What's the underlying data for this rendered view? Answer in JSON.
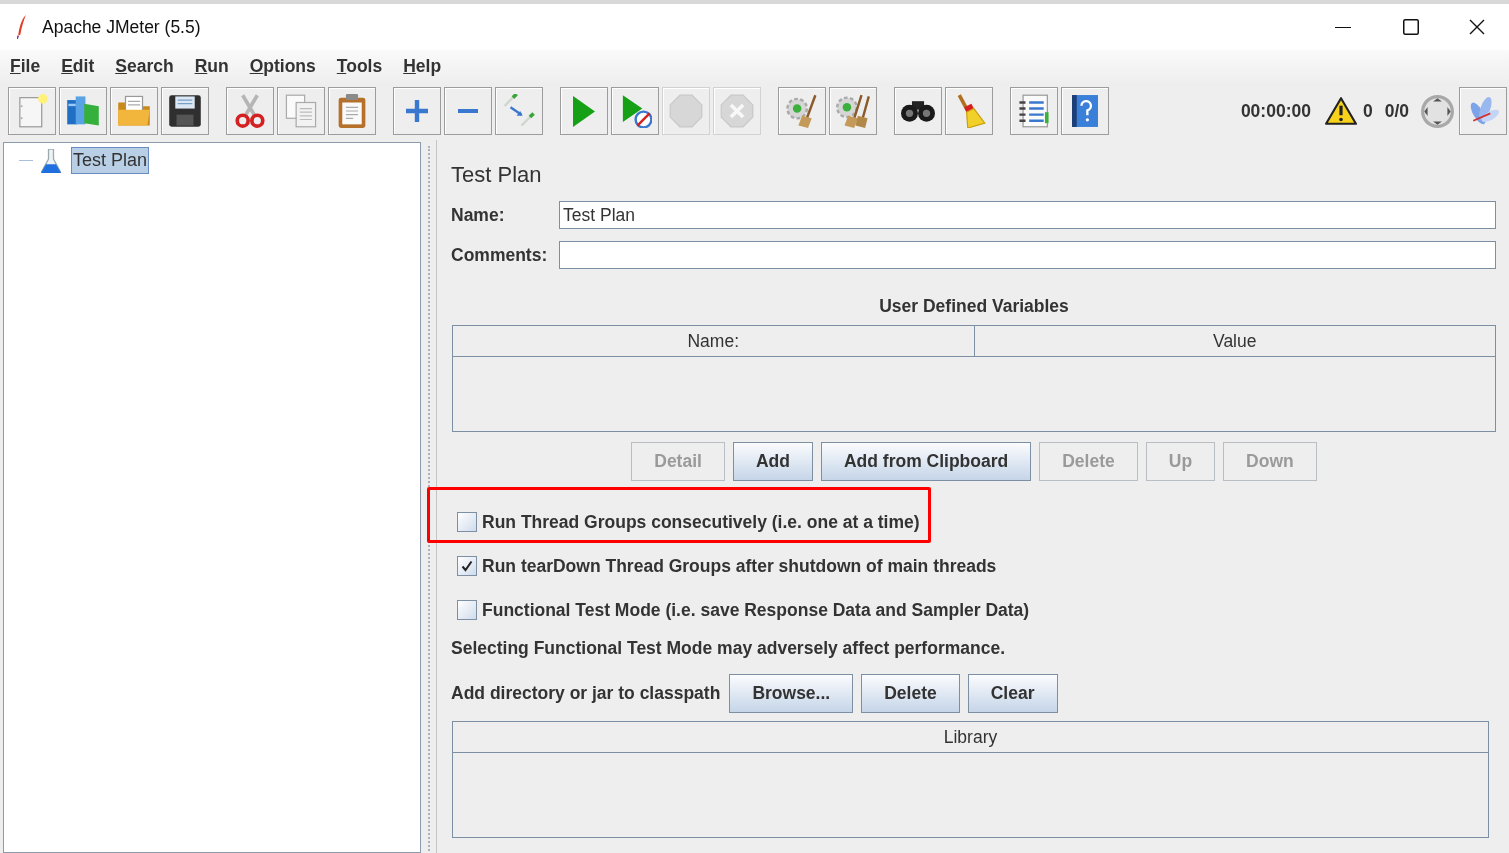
{
  "window": {
    "title": "Apache JMeter (5.5)"
  },
  "menu": [
    "File",
    "Edit",
    "Search",
    "Run",
    "Options",
    "Tools",
    "Help"
  ],
  "toolbar": {
    "groups": [
      [
        {
          "kind": "new",
          "disabled": false
        },
        {
          "kind": "templates",
          "disabled": false
        },
        {
          "kind": "open",
          "disabled": false
        },
        {
          "kind": "save",
          "disabled": false
        }
      ],
      [
        {
          "kind": "cut",
          "disabled": false
        },
        {
          "kind": "copy",
          "disabled": false
        },
        {
          "kind": "paste",
          "disabled": false
        }
      ],
      [
        {
          "kind": "expand",
          "disabled": false
        },
        {
          "kind": "collapse",
          "disabled": false
        },
        {
          "kind": "toggle",
          "disabled": false
        }
      ],
      [
        {
          "kind": "start",
          "disabled": false
        },
        {
          "kind": "start-no-pauses",
          "disabled": false
        },
        {
          "kind": "stop",
          "disabled": true
        },
        {
          "kind": "shutdown",
          "disabled": true
        }
      ],
      [
        {
          "kind": "clear",
          "disabled": false
        },
        {
          "kind": "clear-all",
          "disabled": false
        }
      ],
      [
        {
          "kind": "search",
          "disabled": false
        },
        {
          "kind": "reset-search",
          "disabled": false
        }
      ],
      [
        {
          "kind": "function-helper",
          "disabled": false
        },
        {
          "kind": "help",
          "disabled": false
        }
      ]
    ],
    "elapsed": "00:00:00",
    "warnings": "0",
    "threads": "0/0",
    "trailing": [
      {
        "kind": "feather",
        "disabled": false
      }
    ]
  },
  "tree": [
    {
      "label": "Test Plan",
      "selected": true
    }
  ],
  "panel": {
    "title": "Test Plan",
    "fields": [
      {
        "label": "Name:",
        "value": "Test Plan"
      },
      {
        "label": "Comments:"
      }
    ]
  },
  "variables": {
    "title": "User Defined Variables",
    "columns": [
      "Name:",
      "Value"
    ],
    "buttons": [
      {
        "label": "Detail",
        "disabled": true
      },
      {
        "label": "Add",
        "disabled": false
      },
      {
        "label": "Add from Clipboard",
        "disabled": false
      },
      {
        "label": "Delete",
        "disabled": true
      },
      {
        "label": "Up",
        "disabled": true
      },
      {
        "label": "Down",
        "disabled": true
      }
    ]
  },
  "options": [
    {
      "label": "Run Thread Groups consecutively (i.e. one at a time)",
      "checked": false,
      "highlighted": true
    },
    {
      "label": "Run tearDown Thread Groups after shutdown of main threads",
      "checked": true,
      "highlighted": false
    },
    {
      "label": "Functional Test Mode (i.e. save Response Data and Sampler Data)",
      "checked": false,
      "highlighted": false
    }
  ],
  "note": "Selecting Functional Test Mode may adversely affect performance.",
  "classpath": {
    "label": "Add directory or jar to classpath",
    "buttons": [
      {
        "label": "Browse...",
        "disabled": false
      },
      {
        "label": "Delete",
        "disabled": false
      },
      {
        "label": "Clear",
        "disabled": false
      }
    ],
    "columns": [
      "Library"
    ]
  }
}
